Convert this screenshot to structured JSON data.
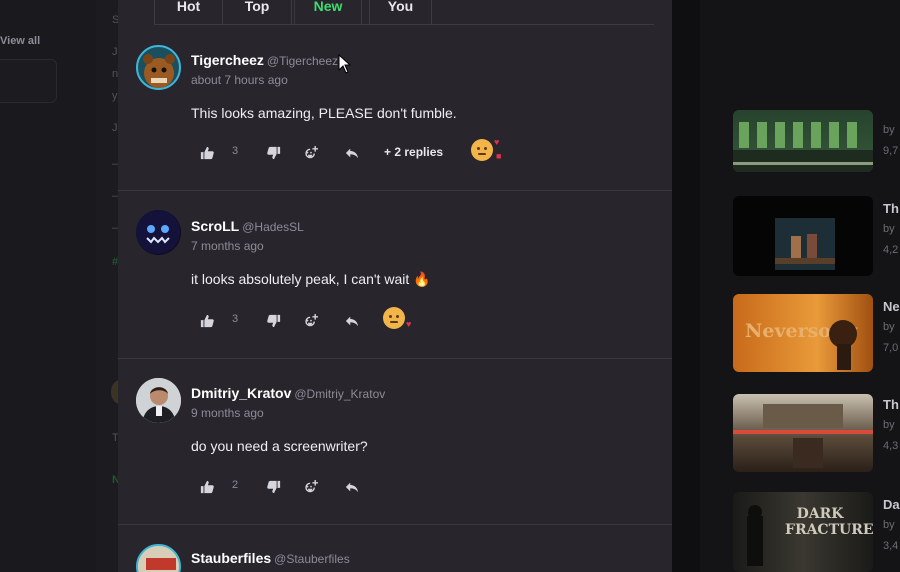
{
  "background": {
    "view_all": "View all",
    "side_titles": [
      "Th",
      "Ne",
      "Th",
      "Da"
    ],
    "side_by": "by",
    "side_counts": [
      "9,7",
      "4,2",
      "7,0",
      "4,3",
      "3,4"
    ],
    "thumb_captions": [
      "Neversong",
      "DARK FRACTURE"
    ]
  },
  "tabs": [
    {
      "label": "Hot",
      "active": false
    },
    {
      "label": "Top",
      "active": false
    },
    {
      "label": "New",
      "active": true
    },
    {
      "label": "You",
      "active": false
    }
  ],
  "comments": [
    {
      "username": "Tigercheez",
      "handle": "@Tigercheez",
      "time": "about 7 hours ago",
      "text": "This looks amazing, PLEASE don't fumble.",
      "likes": "3",
      "replies": "+ 2 replies"
    },
    {
      "username": "ScroLL",
      "handle": "@HadesSL",
      "time": "7 months ago",
      "text": "it looks absolutely peak, I can't wait 🔥",
      "likes": "3"
    },
    {
      "username": "Dmitriy_Kratov",
      "handle": "@Dmitriy_Kratov",
      "time": "9 months ago",
      "text": "do you need a screenwriter?",
      "likes": "2"
    },
    {
      "username": "Stauberfiles",
      "handle": "@Stauberfiles"
    }
  ],
  "colors": {
    "accent": "#3ddc6e",
    "panel": "#28252d",
    "heart": "#e0334a"
  },
  "icons": [
    "thumbs-up-icon",
    "thumbs-down-icon",
    "add-reaction-icon",
    "reply-icon",
    "heart-icon",
    "cursor-icon"
  ]
}
